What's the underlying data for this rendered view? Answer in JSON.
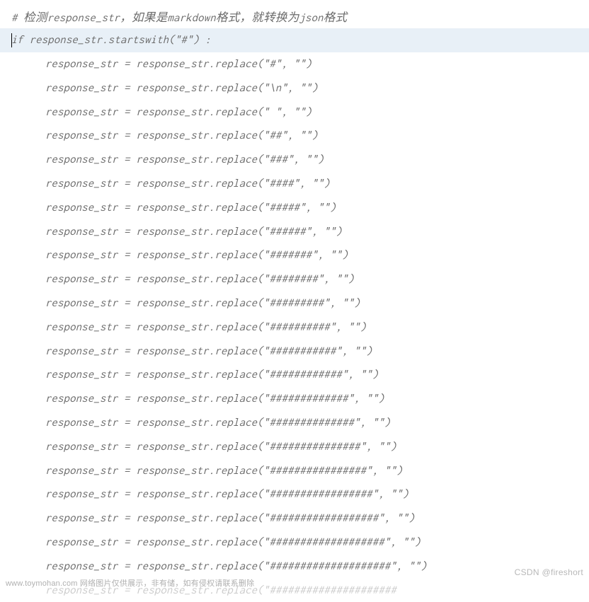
{
  "code": {
    "lines": [
      {
        "text": "# 检测response_str，如果是markdown格式，就转换为json格式",
        "indent": 0,
        "highlighted": false
      },
      {
        "text": "if response_str.startswith(\"#\") :",
        "indent": 0,
        "highlighted": true,
        "cursor": true
      },
      {
        "text": "response_str = response_str.replace(\"#\", \"\")",
        "indent": 1,
        "highlighted": false
      },
      {
        "text": "response_str = response_str.replace(\"\\n\", \"\")",
        "indent": 1,
        "highlighted": false
      },
      {
        "text": "response_str = response_str.replace(\" \", \"\")",
        "indent": 1,
        "highlighted": false
      },
      {
        "text": "response_str = response_str.replace(\"##\", \"\")",
        "indent": 1,
        "highlighted": false
      },
      {
        "text": "response_str = response_str.replace(\"###\", \"\")",
        "indent": 1,
        "highlighted": false
      },
      {
        "text": "response_str = response_str.replace(\"####\", \"\")",
        "indent": 1,
        "highlighted": false
      },
      {
        "text": "response_str = response_str.replace(\"#####\", \"\")",
        "indent": 1,
        "highlighted": false
      },
      {
        "text": "response_str = response_str.replace(\"######\", \"\")",
        "indent": 1,
        "highlighted": false
      },
      {
        "text": "response_str = response_str.replace(\"#######\", \"\")",
        "indent": 1,
        "highlighted": false
      },
      {
        "text": "response_str = response_str.replace(\"########\", \"\")",
        "indent": 1,
        "highlighted": false
      },
      {
        "text": "response_str = response_str.replace(\"#########\", \"\")",
        "indent": 1,
        "highlighted": false
      },
      {
        "text": "response_str = response_str.replace(\"##########\", \"\")",
        "indent": 1,
        "highlighted": false
      },
      {
        "text": "response_str = response_str.replace(\"###########\", \"\")",
        "indent": 1,
        "highlighted": false
      },
      {
        "text": "response_str = response_str.replace(\"############\", \"\")",
        "indent": 1,
        "highlighted": false
      },
      {
        "text": "response_str = response_str.replace(\"#############\", \"\")",
        "indent": 1,
        "highlighted": false
      },
      {
        "text": "response_str = response_str.replace(\"##############\", \"\")",
        "indent": 1,
        "highlighted": false
      },
      {
        "text": "response_str = response_str.replace(\"###############\", \"\")",
        "indent": 1,
        "highlighted": false
      },
      {
        "text": "response_str = response_str.replace(\"################\", \"\")",
        "indent": 1,
        "highlighted": false
      },
      {
        "text": "response_str = response_str.replace(\"#################\", \"\")",
        "indent": 1,
        "highlighted": false
      },
      {
        "text": "response_str = response_str.replace(\"##################\", \"\")",
        "indent": 1,
        "highlighted": false
      },
      {
        "text": "response_str = response_str.replace(\"###################\", \"\")",
        "indent": 1,
        "highlighted": false
      },
      {
        "text": "response_str = response_str.replace(\"####################\", \"\")",
        "indent": 1,
        "highlighted": false
      }
    ],
    "partial_line": "response_str = response_str.replace(\"#####################"
  },
  "watermarks": {
    "bottom": "www.toymohan.com 网络图片仅供展示，非有储，如有侵权请联系删除",
    "right": "CSDN @fireshort"
  }
}
